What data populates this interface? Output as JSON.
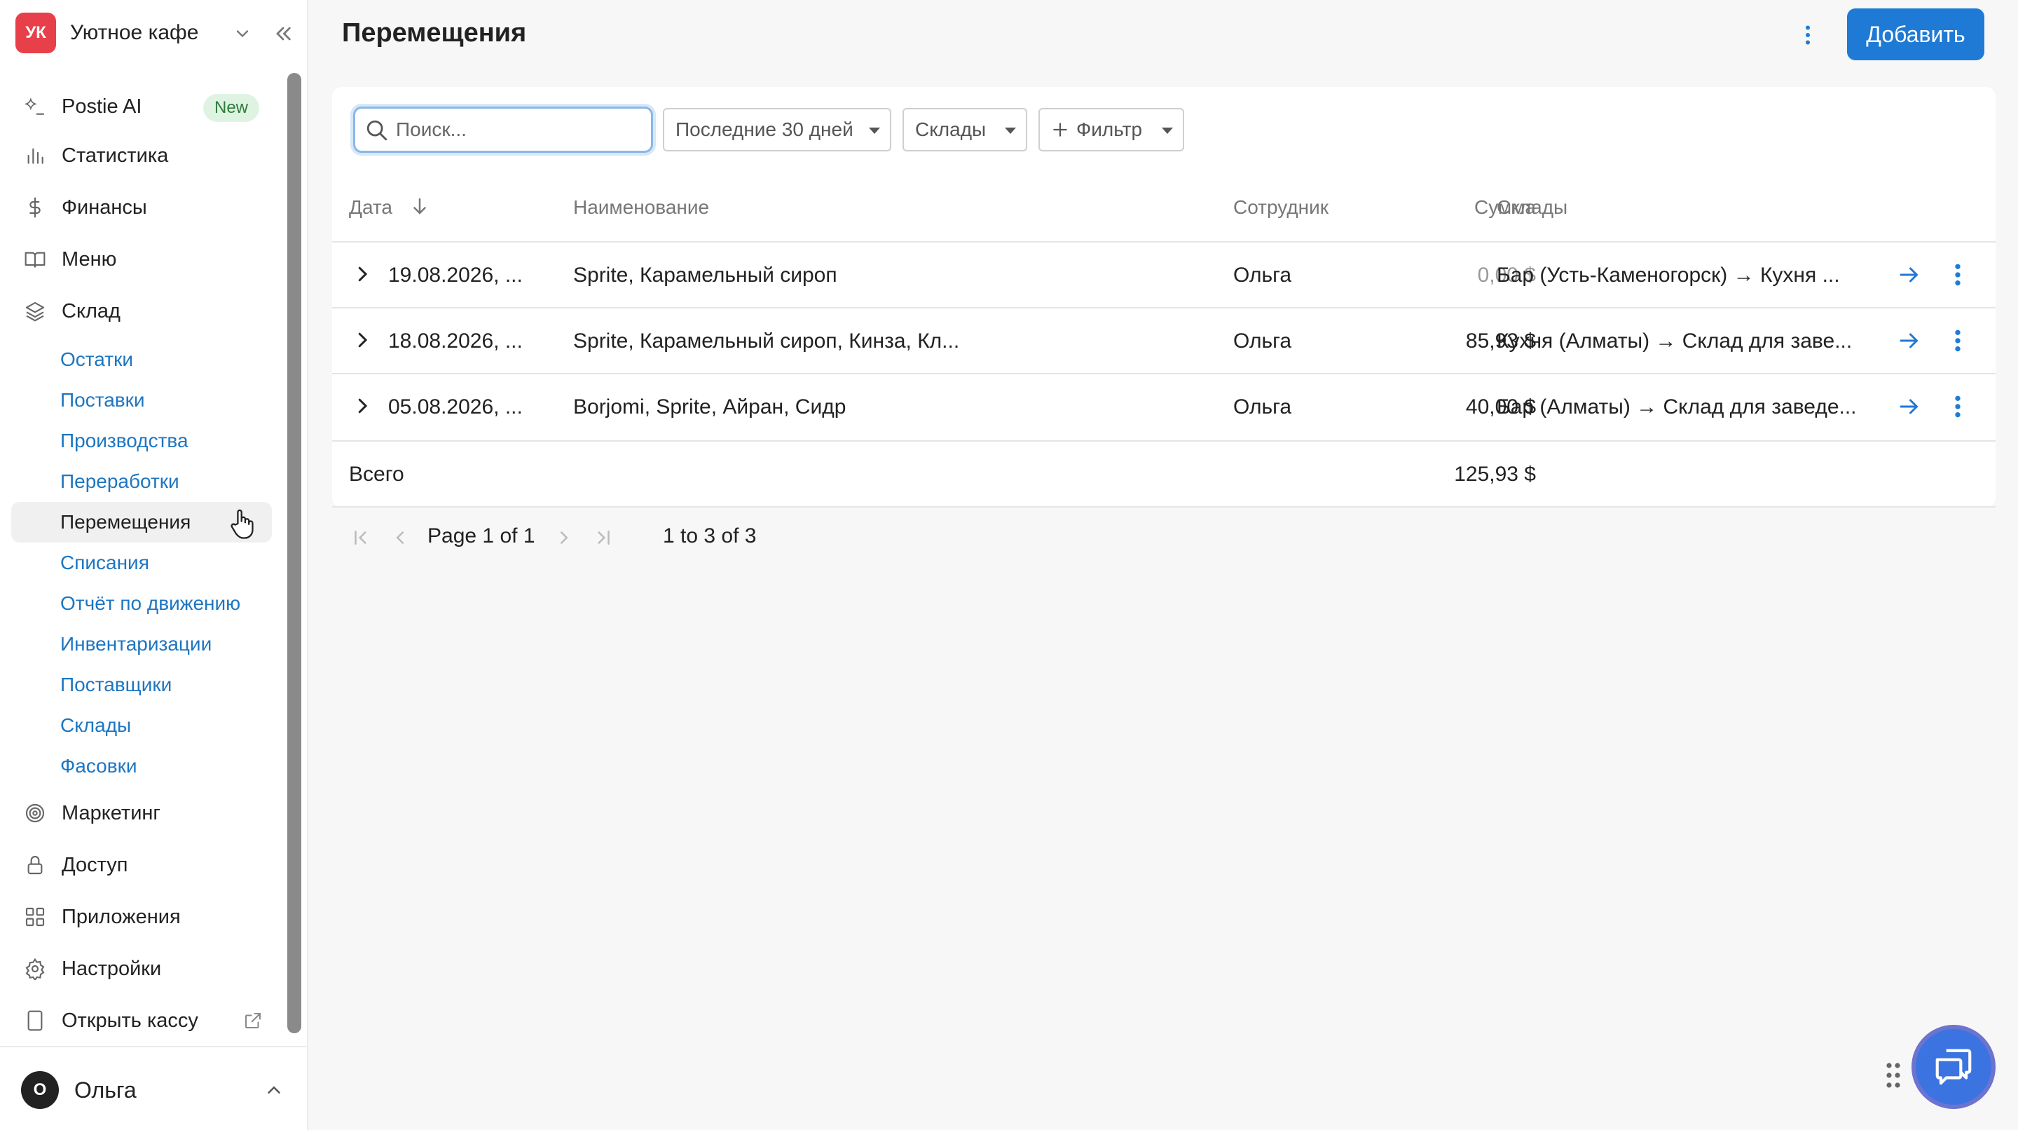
{
  "brand": {
    "initials": "УК",
    "name": "Уютное кафе"
  },
  "nav": {
    "items": [
      {
        "label": "Postie AI",
        "badge": "New"
      },
      {
        "label": "Статистика"
      },
      {
        "label": "Финансы"
      },
      {
        "label": "Меню"
      },
      {
        "label": "Склад"
      },
      {
        "label": "Маркетинг"
      },
      {
        "label": "Доступ"
      },
      {
        "label": "Приложения"
      },
      {
        "label": "Настройки"
      },
      {
        "label": "Открыть кассу"
      }
    ],
    "warehouse_sub": [
      "Остатки",
      "Поставки",
      "Производства",
      "Переработки",
      "Перемещения",
      "Списания",
      "Отчёт по движению",
      "Инвентаризации",
      "Поставщики",
      "Склады",
      "Фасовки"
    ],
    "active_sub": "Перемещения"
  },
  "user": {
    "initial": "О",
    "name": "Ольга"
  },
  "header": {
    "title": "Перемещения",
    "add_label": "Добавить"
  },
  "toolbar": {
    "search_placeholder": "Поиск...",
    "period": "Последние 30 дней",
    "warehouses": "Склады",
    "filter": "Фильтр"
  },
  "table": {
    "columns": {
      "date": "Дата",
      "name": "Наименование",
      "sum": "Сумма",
      "employee": "Сотрудник",
      "warehouses": "Склады"
    },
    "rows": [
      {
        "date": "19.08.2026, ...",
        "name": "Sprite, Карамельный сироп",
        "sum": "0,00 $",
        "employee": "Ольга",
        "route": "Бар (Усть-Каменогорск) → Кухня ..."
      },
      {
        "date": "18.08.2026, ...",
        "name": "Sprite, Карамельный сироп, Кинза, Кл...",
        "sum": "85,93 $",
        "employee": "Ольга",
        "route": "Кухня (Алматы) → Склад для заве..."
      },
      {
        "date": "05.08.2026, ...",
        "name": "Borjomi, Sprite, Айран, Сидр",
        "sum": "40,00 $",
        "employee": "Ольга",
        "route": "Бар (Алматы) → Склад для заведе..."
      }
    ],
    "total_label": "Всего",
    "total_value": "125,93 $"
  },
  "pager": {
    "page_prefix": "Page",
    "page_current": "1",
    "page_of": "of",
    "page_total": "1",
    "range_text": "1 to 3 of 3"
  },
  "colors": {
    "accent": "#1f7ad6",
    "link": "#1d76c2",
    "brand_avatar": "#e8404a",
    "badge_bg": "#dff3e2",
    "badge_text": "#2e7d3a"
  }
}
